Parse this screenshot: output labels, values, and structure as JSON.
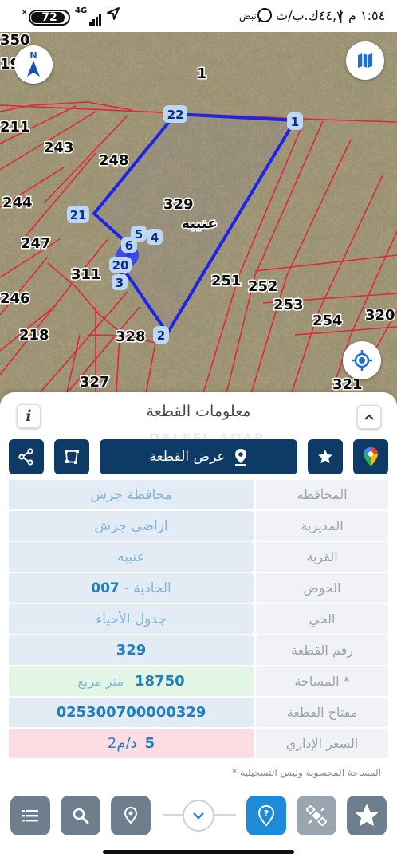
{
  "status_bar": {
    "battery": "72",
    "network": "4G",
    "time": "١:٥٤ م",
    "speed": "٤٤,٧ك.ب/ث",
    "carrier": "نبض"
  },
  "map": {
    "plot_main_number": "329",
    "village_label": "عنيبه",
    "parcel_numbers": {
      "n350": "350",
      "n19": "19",
      "n1": "1",
      "n211": "211",
      "n243": "243",
      "n248": "248",
      "n244": "244",
      "n247": "247",
      "n311": "311",
      "n246": "246",
      "n218": "218",
      "n328": "328",
      "n327": "327",
      "n251": "251",
      "n252": "252",
      "n253": "253",
      "n254": "254",
      "n320": "320",
      "n321": "321"
    },
    "vertex_labels": {
      "v1": "1",
      "v2": "2",
      "v3": "3",
      "v4": "4",
      "v5": "5",
      "v6": "6",
      "v20": "20",
      "v21": "21",
      "v22": "22"
    },
    "compass_letter": "N"
  },
  "panel": {
    "title": "معلومات القطعة",
    "info_icon_label": "i",
    "show_plot_label": "عرض القطعة",
    "watermark": "DALEEL AQAR",
    "footnote": "* المساحة المحسوبة وليس التسجيلية"
  },
  "rows": [
    {
      "label": "المحافظة",
      "value": "محافظة جرش"
    },
    {
      "label": "المديرية",
      "value": "اراضي جرش"
    },
    {
      "label": "القرية",
      "value": "عنيبه"
    },
    {
      "label": "الحوض",
      "value_name": "الحادية -",
      "value_num": "007"
    },
    {
      "label": "الحي",
      "value": "جدول الأحياء"
    },
    {
      "label": "رقم القطعة",
      "value": "329"
    },
    {
      "label": "المساحة *",
      "value_num": "18750",
      "value_unit": "متر مربع"
    },
    {
      "label": "مفتاح القطعة",
      "value": "025300700000329"
    },
    {
      "label": "السعر الإداري",
      "value_num": "5",
      "value_unit": "د/م2"
    }
  ],
  "colors": {
    "navy": "#0d3b66",
    "accent_blue": "#1f8ad8",
    "parcel_red": "#e0263a",
    "selection_blue": "#1d25e8"
  }
}
